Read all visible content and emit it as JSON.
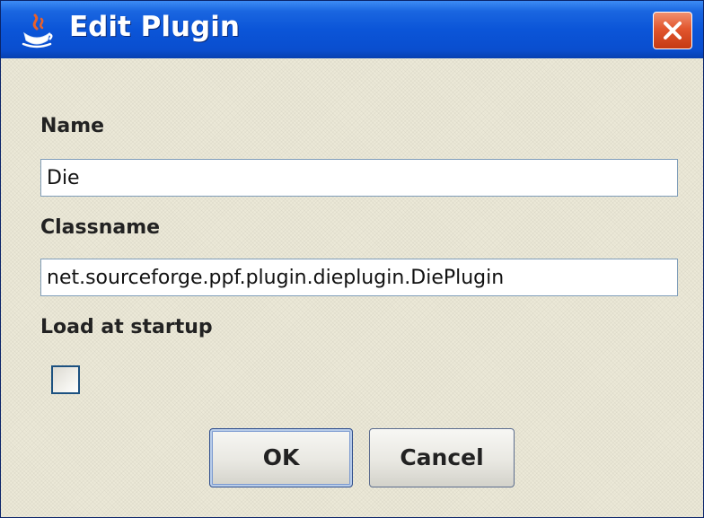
{
  "window": {
    "title": "Edit Plugin",
    "icon": "java-icon",
    "close_icon": "close-icon",
    "close_color": "#e2562e",
    "title_color": "#0b55d8"
  },
  "form": {
    "name_label": "Name",
    "name_value": "Die",
    "classname_label": "Classname",
    "classname_value": "net.sourceforge.ppf.plugin.dieplugin.DiePlugin",
    "load_label": "Load at startup",
    "load_checked": false
  },
  "buttons": {
    "ok_label": "OK",
    "cancel_label": "Cancel"
  }
}
